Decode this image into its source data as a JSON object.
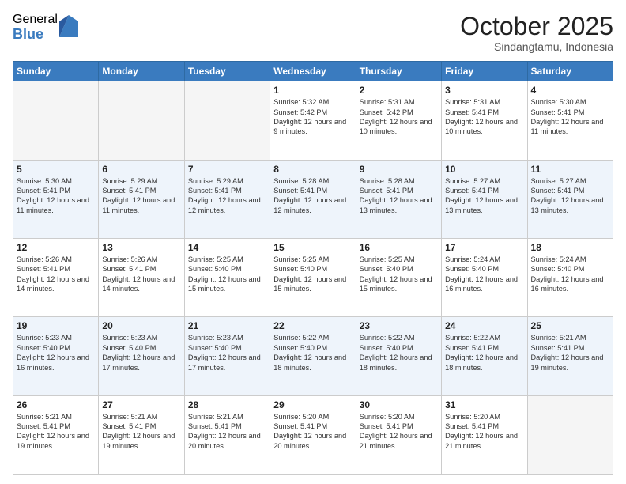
{
  "logo": {
    "general": "General",
    "blue": "Blue"
  },
  "title": "October 2025",
  "location": "Sindangtamu, Indonesia",
  "days_of_week": [
    "Sunday",
    "Monday",
    "Tuesday",
    "Wednesday",
    "Thursday",
    "Friday",
    "Saturday"
  ],
  "weeks": [
    {
      "days": [
        {
          "number": "",
          "info": ""
        },
        {
          "number": "",
          "info": ""
        },
        {
          "number": "",
          "info": ""
        },
        {
          "number": "1",
          "info": "Sunrise: 5:32 AM\nSunset: 5:42 PM\nDaylight: 12 hours\nand 9 minutes."
        },
        {
          "number": "2",
          "info": "Sunrise: 5:31 AM\nSunset: 5:42 PM\nDaylight: 12 hours\nand 10 minutes."
        },
        {
          "number": "3",
          "info": "Sunrise: 5:31 AM\nSunset: 5:41 PM\nDaylight: 12 hours\nand 10 minutes."
        },
        {
          "number": "4",
          "info": "Sunrise: 5:30 AM\nSunset: 5:41 PM\nDaylight: 12 hours\nand 11 minutes."
        }
      ]
    },
    {
      "days": [
        {
          "number": "5",
          "info": "Sunrise: 5:30 AM\nSunset: 5:41 PM\nDaylight: 12 hours\nand 11 minutes."
        },
        {
          "number": "6",
          "info": "Sunrise: 5:29 AM\nSunset: 5:41 PM\nDaylight: 12 hours\nand 11 minutes."
        },
        {
          "number": "7",
          "info": "Sunrise: 5:29 AM\nSunset: 5:41 PM\nDaylight: 12 hours\nand 12 minutes."
        },
        {
          "number": "8",
          "info": "Sunrise: 5:28 AM\nSunset: 5:41 PM\nDaylight: 12 hours\nand 12 minutes."
        },
        {
          "number": "9",
          "info": "Sunrise: 5:28 AM\nSunset: 5:41 PM\nDaylight: 12 hours\nand 13 minutes."
        },
        {
          "number": "10",
          "info": "Sunrise: 5:27 AM\nSunset: 5:41 PM\nDaylight: 12 hours\nand 13 minutes."
        },
        {
          "number": "11",
          "info": "Sunrise: 5:27 AM\nSunset: 5:41 PM\nDaylight: 12 hours\nand 13 minutes."
        }
      ]
    },
    {
      "days": [
        {
          "number": "12",
          "info": "Sunrise: 5:26 AM\nSunset: 5:41 PM\nDaylight: 12 hours\nand 14 minutes."
        },
        {
          "number": "13",
          "info": "Sunrise: 5:26 AM\nSunset: 5:41 PM\nDaylight: 12 hours\nand 14 minutes."
        },
        {
          "number": "14",
          "info": "Sunrise: 5:25 AM\nSunset: 5:40 PM\nDaylight: 12 hours\nand 15 minutes."
        },
        {
          "number": "15",
          "info": "Sunrise: 5:25 AM\nSunset: 5:40 PM\nDaylight: 12 hours\nand 15 minutes."
        },
        {
          "number": "16",
          "info": "Sunrise: 5:25 AM\nSunset: 5:40 PM\nDaylight: 12 hours\nand 15 minutes."
        },
        {
          "number": "17",
          "info": "Sunrise: 5:24 AM\nSunset: 5:40 PM\nDaylight: 12 hours\nand 16 minutes."
        },
        {
          "number": "18",
          "info": "Sunrise: 5:24 AM\nSunset: 5:40 PM\nDaylight: 12 hours\nand 16 minutes."
        }
      ]
    },
    {
      "days": [
        {
          "number": "19",
          "info": "Sunrise: 5:23 AM\nSunset: 5:40 PM\nDaylight: 12 hours\nand 16 minutes."
        },
        {
          "number": "20",
          "info": "Sunrise: 5:23 AM\nSunset: 5:40 PM\nDaylight: 12 hours\nand 17 minutes."
        },
        {
          "number": "21",
          "info": "Sunrise: 5:23 AM\nSunset: 5:40 PM\nDaylight: 12 hours\nand 17 minutes."
        },
        {
          "number": "22",
          "info": "Sunrise: 5:22 AM\nSunset: 5:40 PM\nDaylight: 12 hours\nand 18 minutes."
        },
        {
          "number": "23",
          "info": "Sunrise: 5:22 AM\nSunset: 5:40 PM\nDaylight: 12 hours\nand 18 minutes."
        },
        {
          "number": "24",
          "info": "Sunrise: 5:22 AM\nSunset: 5:41 PM\nDaylight: 12 hours\nand 18 minutes."
        },
        {
          "number": "25",
          "info": "Sunrise: 5:21 AM\nSunset: 5:41 PM\nDaylight: 12 hours\nand 19 minutes."
        }
      ]
    },
    {
      "days": [
        {
          "number": "26",
          "info": "Sunrise: 5:21 AM\nSunset: 5:41 PM\nDaylight: 12 hours\nand 19 minutes."
        },
        {
          "number": "27",
          "info": "Sunrise: 5:21 AM\nSunset: 5:41 PM\nDaylight: 12 hours\nand 19 minutes."
        },
        {
          "number": "28",
          "info": "Sunrise: 5:21 AM\nSunset: 5:41 PM\nDaylight: 12 hours\nand 20 minutes."
        },
        {
          "number": "29",
          "info": "Sunrise: 5:20 AM\nSunset: 5:41 PM\nDaylight: 12 hours\nand 20 minutes."
        },
        {
          "number": "30",
          "info": "Sunrise: 5:20 AM\nSunset: 5:41 PM\nDaylight: 12 hours\nand 21 minutes."
        },
        {
          "number": "31",
          "info": "Sunrise: 5:20 AM\nSunset: 5:41 PM\nDaylight: 12 hours\nand 21 minutes."
        },
        {
          "number": "",
          "info": ""
        }
      ]
    }
  ]
}
